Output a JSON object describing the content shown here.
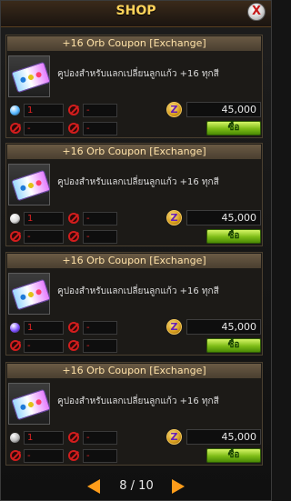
{
  "shop": {
    "title": "SHOP",
    "close_label": "X"
  },
  "items": [
    {
      "name": "+16 Orb Coupon [Exchange]",
      "description": "คูปองสำหรับแลกเปลี่ยนลูกแก้ว +16 ทุกสี",
      "quantity": "1",
      "slot2": "-",
      "slot3": "-",
      "slot4": "-",
      "price": "45,000",
      "currency_icon": "Z",
      "buy_label": "ซื้อ",
      "orb_color": "#4fb4ff"
    },
    {
      "name": "+16 Orb Coupon [Exchange]",
      "description": "คูปองสำหรับแลกเปลี่ยนลูกแก้ว +16 ทุกสี",
      "quantity": "1",
      "slot2": "-",
      "slot3": "-",
      "slot4": "-",
      "price": "45,000",
      "currency_icon": "Z",
      "buy_label": "ซื้อ",
      "orb_color": "#d8d8d8"
    },
    {
      "name": "+16 Orb Coupon [Exchange]",
      "description": "คูปองสำหรับแลกเปลี่ยนลูกแก้ว +16 ทุกสี",
      "quantity": "1",
      "slot2": "-",
      "slot3": "-",
      "slot4": "-",
      "price": "45,000",
      "currency_icon": "Z",
      "buy_label": "ซื้อ",
      "orb_color": "#7b4dff"
    },
    {
      "name": "+16 Orb Coupon [Exchange]",
      "description": "คูปองสำหรับแลกเปลี่ยนลูกแก้ว +16 ทุกสี",
      "quantity": "1",
      "slot2": "-",
      "slot3": "-",
      "slot4": "-",
      "price": "45,000",
      "currency_icon": "Z",
      "buy_label": "ซื้อ",
      "orb_color": "#b7b7b7"
    }
  ],
  "pager": {
    "text": "8 / 10"
  },
  "colors": {
    "title": "#ffd35a",
    "header_text": "#ffe2a8",
    "accent_orange": "#ff9c1a",
    "buy_green": "#7cbb16",
    "red": "#e02424"
  },
  "icons": {
    "close": "close-icon",
    "coupon": "coupon-icon",
    "orb": "orb-icon",
    "forbidden": "forbidden-icon",
    "currency": "zen-coin-icon",
    "prev": "arrow-left-icon",
    "next": "arrow-right-icon"
  }
}
